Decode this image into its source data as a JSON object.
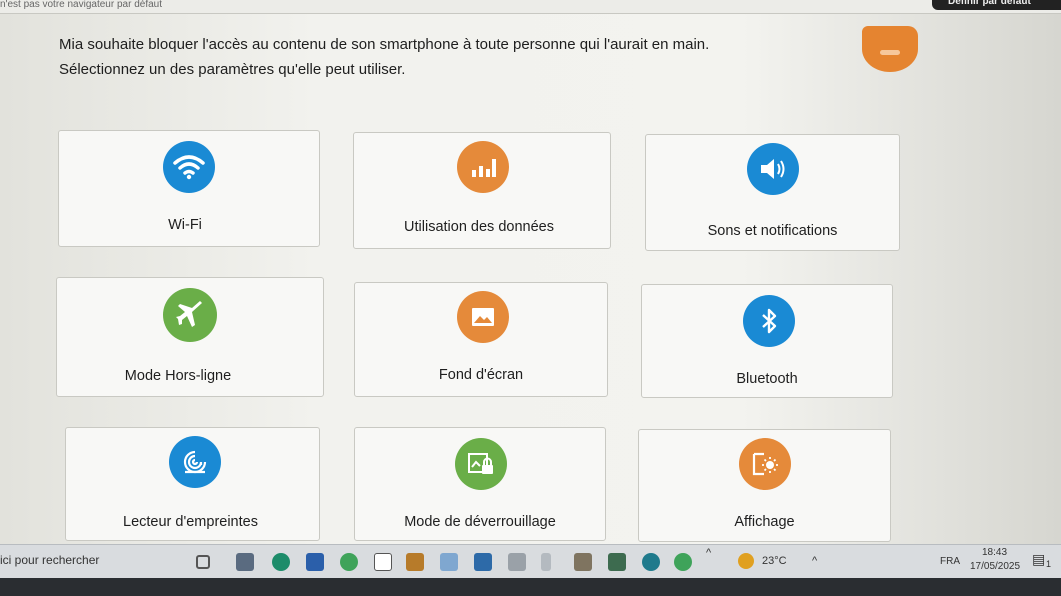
{
  "browser": {
    "note": "n'est pas votre navigateur par défaut",
    "default_button": "Définir par défaut"
  },
  "question": {
    "line1": "Mia souhaite bloquer l'accès au contenu de son smartphone à toute personne qui l'aurait en main.",
    "line2": "Sélectionnez un des paramètres qu'elle peut utiliser."
  },
  "options": [
    {
      "label": "Wi-Fi",
      "icon": "wifi-icon",
      "color": "#1a8ad4"
    },
    {
      "label": "Utilisation des données",
      "icon": "data-usage-icon",
      "color": "#e58a3a"
    },
    {
      "label": "Sons et notifications",
      "icon": "sound-icon",
      "color": "#1a8ad4"
    },
    {
      "label": "Mode Hors-ligne",
      "icon": "airplane-icon",
      "color": "#6aae48"
    },
    {
      "label": "Fond d'écran",
      "icon": "wallpaper-icon",
      "color": "#e58a3a"
    },
    {
      "label": "Bluetooth",
      "icon": "bluetooth-icon",
      "color": "#1a8ad4"
    },
    {
      "label": "Lecteur d'empreintes",
      "icon": "fingerprint-icon",
      "color": "#1a8ad4"
    },
    {
      "label": "Mode de déverrouillage",
      "icon": "lock-screen-icon",
      "color": "#6aae48"
    },
    {
      "label": "Affichage",
      "icon": "display-icon",
      "color": "#e58a3a"
    }
  ],
  "taskbar": {
    "search_placeholder": "ici pour rechercher",
    "temperature": "23°C",
    "language": "FRA",
    "time": "18:43",
    "date": "17/05/2025",
    "notification_count": "1"
  }
}
